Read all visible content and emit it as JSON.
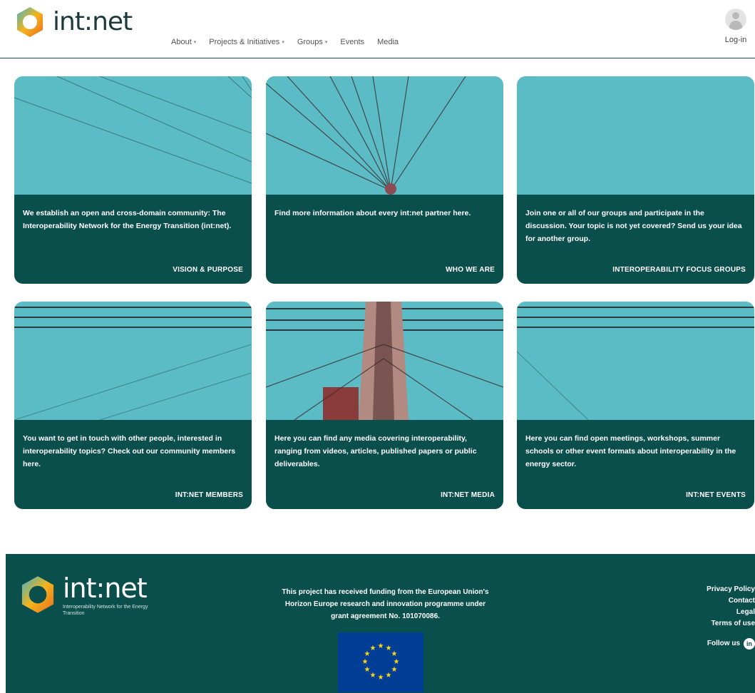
{
  "brand": {
    "name": "int:net",
    "subtitle": "Interoperability Network for the Energy Transition"
  },
  "nav": {
    "items": [
      {
        "label": "About",
        "caret": "▾"
      },
      {
        "label": "Projects & Initiatives",
        "caret": "▾"
      },
      {
        "label": "Groups",
        "caret": "▾"
      },
      {
        "label": "Events",
        "caret": ""
      },
      {
        "label": "Media",
        "caret": ""
      }
    ],
    "login": "Log-in"
  },
  "cards": [
    {
      "desc": "We establish an open and cross-domain community: The Interoperability Network for the Energy Transition (int:net).",
      "title": "VISION & PURPOSE"
    },
    {
      "desc": "Find more information about every int:net partner here.",
      "title": "WHO WE ARE"
    },
    {
      "desc": "Join one or all of our groups and participate in the discussion. Your topic is not yet covered? Send us your idea for another group.",
      "title": "INTEROPERABILITY FOCUS GROUPS"
    },
    {
      "desc": "You want to get in touch with other people, interested in interoperability topics? Check out our community members here.",
      "title": "INT:NET MEMBERS"
    },
    {
      "desc": "Here you can find any media covering interoperability, ranging from videos, articles, published papers or public deliverables.",
      "title": "INT:NET MEDIA"
    },
    {
      "desc": "Here you can find open meetings, workshops, summer schools or other event formats about interoperability in the energy sector.",
      "title": "INT:NET EVENTS"
    }
  ],
  "footer": {
    "funding": "This project has received funding from the European Union's Horizon Europe research and innovation programme under grant agreement No. 101070086.",
    "links": [
      "Privacy Policy",
      "Contact",
      "Legal",
      "Terms of use"
    ],
    "follow": "Follow us",
    "linkedin_icon": "in"
  },
  "colors": {
    "accent": "#0b4f4d",
    "sky": "#5bbcc6"
  }
}
